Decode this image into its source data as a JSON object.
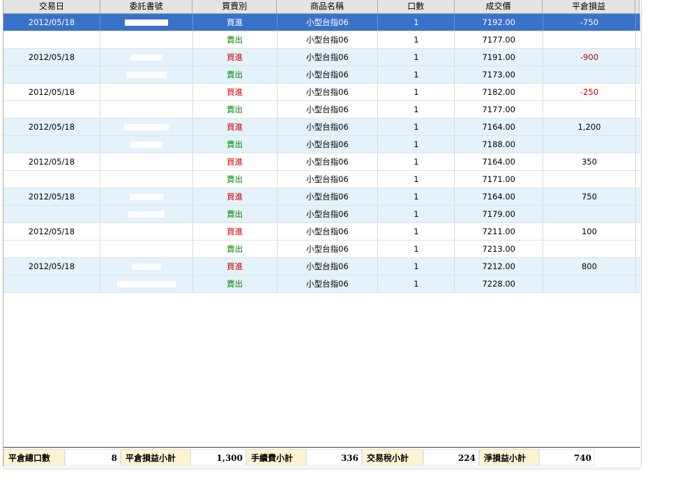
{
  "columns": [
    "交易日",
    "委託書號",
    "買賣別",
    "商品名稱",
    "口數",
    "成交價",
    "平倉損益"
  ],
  "rows": [
    {
      "date": "2012/05/18",
      "side": "買進",
      "product": "小型台指06",
      "qty": "1",
      "price": "7192.00",
      "pnl": "-750",
      "redact_w": 62
    },
    {
      "date": "",
      "side": "賣出",
      "product": "小型台指06",
      "qty": "1",
      "price": "7177.00",
      "pnl": "",
      "redact_w": 40
    },
    {
      "date": "2012/05/18",
      "side": "買進",
      "product": "小型台指06",
      "qty": "1",
      "price": "7191.00",
      "pnl": "-900",
      "redact_w": 46
    },
    {
      "date": "",
      "side": "賣出",
      "product": "小型台指06",
      "qty": "1",
      "price": "7173.00",
      "pnl": "",
      "redact_w": 58
    },
    {
      "date": "2012/05/18",
      "side": "買進",
      "product": "小型台指06",
      "qty": "1",
      "price": "7182.00",
      "pnl": "-250",
      "redact_w": 30
    },
    {
      "date": "",
      "side": "賣出",
      "product": "小型台指06",
      "qty": "1",
      "price": "7177.00",
      "pnl": "",
      "redact_w": 44
    },
    {
      "date": "2012/05/18",
      "side": "買進",
      "product": "小型台指06",
      "qty": "1",
      "price": "7164.00",
      "pnl": "1,200",
      "redact_w": 64
    },
    {
      "date": "",
      "side": "賣出",
      "product": "小型台指06",
      "qty": "1",
      "price": "7188.00",
      "pnl": "",
      "redact_w": 46
    },
    {
      "date": "2012/05/18",
      "side": "買進",
      "product": "小型台指06",
      "qty": "1",
      "price": "7164.00",
      "pnl": "350",
      "redact_w": 44
    },
    {
      "date": "",
      "side": "賣出",
      "product": "小型台指06",
      "qty": "1",
      "price": "7171.00",
      "pnl": "",
      "redact_w": 44
    },
    {
      "date": "2012/05/18",
      "side": "買進",
      "product": "小型台指06",
      "qty": "1",
      "price": "7164.00",
      "pnl": "750",
      "redact_w": 48
    },
    {
      "date": "",
      "side": "賣出",
      "product": "小型台指06",
      "qty": "1",
      "price": "7179.00",
      "pnl": "",
      "redact_w": 52
    },
    {
      "date": "2012/05/18",
      "side": "買進",
      "product": "小型台指06",
      "qty": "1",
      "price": "7211.00",
      "pnl": "100",
      "redact_w": 44
    },
    {
      "date": "",
      "side": "賣出",
      "product": "小型台指06",
      "qty": "1",
      "price": "7213.00",
      "pnl": "",
      "redact_w": 0
    },
    {
      "date": "2012/05/18",
      "side": "買進",
      "product": "小型台指06",
      "qty": "1",
      "price": "7212.00",
      "pnl": "800",
      "redact_w": 42
    },
    {
      "date": "",
      "side": "賣出",
      "product": "小型台指06",
      "qty": "1",
      "price": "7228.00",
      "pnl": "",
      "redact_w": 84
    }
  ],
  "footer": {
    "close_qty_label": "平倉總口數",
    "close_qty_value": "8",
    "pnl_subtotal_label": "平倉損益小計",
    "pnl_subtotal_value": "1,300",
    "fee_subtotal_label": "手續費小計",
    "fee_subtotal_value": "336",
    "tax_subtotal_label": "交易稅小計",
    "tax_subtotal_value": "224",
    "net_pnl_label": "淨損益小計",
    "net_pnl_value": "740"
  },
  "colors": {
    "selected_row": "#3a72c9",
    "alt_row": "#e3f2fb",
    "buy": "#d40000",
    "sell": "#008a00",
    "negative": "#c00000",
    "footer_label_bg": "#fff4d1"
  }
}
